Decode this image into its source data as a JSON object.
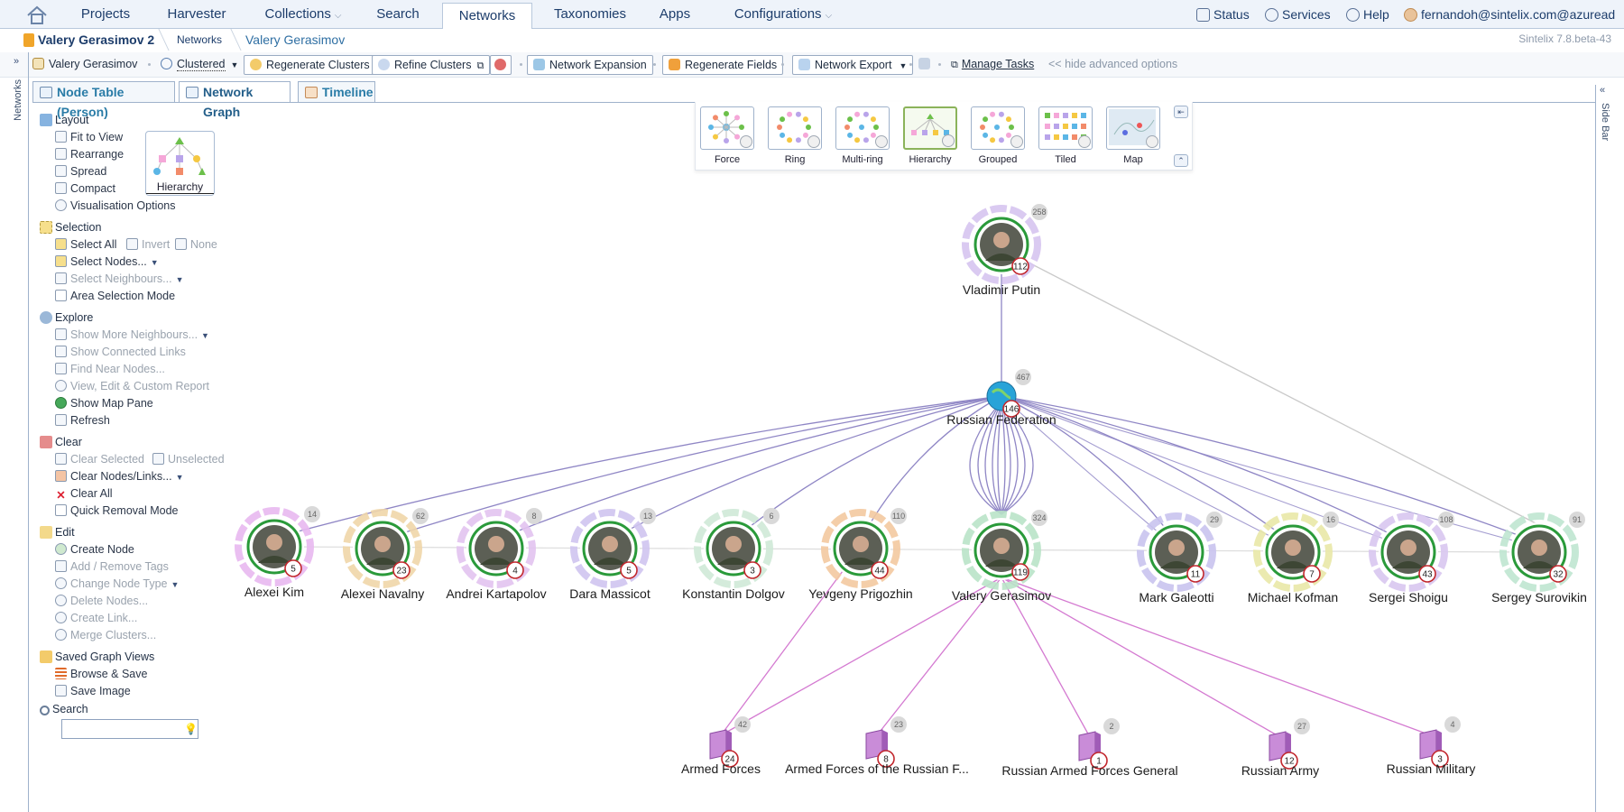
{
  "nav": {
    "tabs": [
      "Projects",
      "Harvester",
      "Collections",
      "Search",
      "Networks",
      "Taxonomies",
      "Apps",
      "Configurations"
    ],
    "active": "Networks",
    "status": "Status",
    "services": "Services",
    "help": "Help",
    "user": "fernandoh@sintelix.com@azuread"
  },
  "breadcrumb": {
    "root": "Valery Gerasimov 2",
    "section": "Networks",
    "current": "Valery Gerasimov"
  },
  "version": "Sintelix 7.8.beta-43",
  "toolbar": {
    "entity": "Valery Gerasimov",
    "clustered": "Clustered",
    "regen_clusters": "Regenerate Clusters",
    "refine_clusters": "Refine Clusters",
    "network_expansion": "Network Expansion",
    "regen_fields": "Regenerate Fields",
    "network_export": "Network Export",
    "manage_tasks": "Manage Tasks",
    "hide_advanced": "<< hide advanced options"
  },
  "strips": {
    "left": "Networks",
    "right": "Side Bar"
  },
  "tabs": [
    "Node Table (Person)",
    "Network Graph",
    "Timeline"
  ],
  "active_tab": "Network Graph",
  "left_panel": {
    "layout": {
      "title": "Layout",
      "items": [
        "Fit to View",
        "Rearrange",
        "Spread",
        "Compact",
        "Visualisation Options"
      ],
      "current": "Hierarchy"
    },
    "selection": {
      "title": "Selection",
      "select_all": "Select All",
      "invert": "Invert",
      "none": "None",
      "select_nodes": "Select Nodes...",
      "select_neighbours": "Select Neighbours...",
      "area_mode": "Area Selection Mode"
    },
    "explore": {
      "title": "Explore",
      "items": [
        "Show More Neighbours...",
        "Show Connected Links",
        "Find Near Nodes...",
        "View, Edit & Custom Report",
        "Show Map Pane",
        "Refresh"
      ]
    },
    "clear": {
      "title": "Clear",
      "clear_selected": "Clear Selected",
      "unselected": "Unselected",
      "clear_nodes_links": "Clear Nodes/Links...",
      "clear_all": "Clear All",
      "quick_removal": "Quick Removal Mode"
    },
    "edit": {
      "title": "Edit",
      "items": [
        "Create Node",
        "Add / Remove Tags",
        "Change Node Type",
        "Delete Nodes...",
        "Create Link...",
        "Merge Clusters..."
      ]
    },
    "saved_views": {
      "title": "Saved Graph Views",
      "items": [
        "Browse & Save",
        "Save Image"
      ]
    },
    "search": {
      "title": "Search"
    }
  },
  "layouts": [
    "Force",
    "Ring",
    "Multi-ring",
    "Hierarchy",
    "Grouped",
    "Tiled",
    "Map"
  ],
  "active_layout": "Hierarchy",
  "nodes": {
    "root": {
      "name": "Vladimir Putin",
      "badge": "112",
      "gray": "258"
    },
    "hub": {
      "name": "Russian Federation",
      "badge": "146",
      "gray": "467"
    },
    "persons": [
      {
        "name": "Alexei Kim",
        "badge": "5",
        "gray": "14",
        "ring": "#e8b8ef"
      },
      {
        "name": "Alexei Navalny",
        "badge": "23",
        "gray": "62",
        "ring": "#f0d6a8"
      },
      {
        "name": "Andrei Kartapolov",
        "badge": "4",
        "gray": "8",
        "ring": "#e2c3f0"
      },
      {
        "name": "Dara Massicot",
        "badge": "5",
        "gray": "13",
        "ring": "#cfc4f0"
      },
      {
        "name": "Konstantin Dolgov",
        "badge": "3",
        "gray": "6",
        "ring": "#cfe9d7"
      },
      {
        "name": "Yevgeny Prigozhin",
        "badge": "44",
        "gray": "110",
        "ring": "#f3c9a0"
      },
      {
        "name": "Valery Gerasimov",
        "badge": "119",
        "gray": "324",
        "ring": "#b9e3c8"
      },
      {
        "name": "Mark Galeotti",
        "badge": "11",
        "gray": "29",
        "ring": "#c9c3ee"
      },
      {
        "name": "Michael Kofman",
        "badge": "7",
        "gray": "16",
        "ring": "#e9e8a7"
      },
      {
        "name": "Sergei Shoigu",
        "badge": "43",
        "gray": "108",
        "ring": "#d8c6f0"
      },
      {
        "name": "Sergey Surovikin",
        "badge": "32",
        "gray": "91",
        "ring": "#bfe5d0"
      }
    ],
    "orgs": [
      {
        "name": "Armed Forces",
        "badge": "24",
        "gray": "42"
      },
      {
        "name": "Armed Forces of the Russian F...",
        "badge": "8",
        "gray": "23"
      },
      {
        "name": "Russian Armed Forces General",
        "badge": "1",
        "gray": "2"
      },
      {
        "name": "Russian Army",
        "badge": "12",
        "gray": "27"
      },
      {
        "name": "Russian Military",
        "badge": "3",
        "gray": "4"
      }
    ]
  },
  "colors": {
    "nav_text": "#1d3d6b",
    "link_gray": "#c9c9c9",
    "link_purple": "#8f86c5",
    "link_pink": "#d47ad1",
    "node_border": "#2a9a3a",
    "badge_border": "#c2272d"
  }
}
